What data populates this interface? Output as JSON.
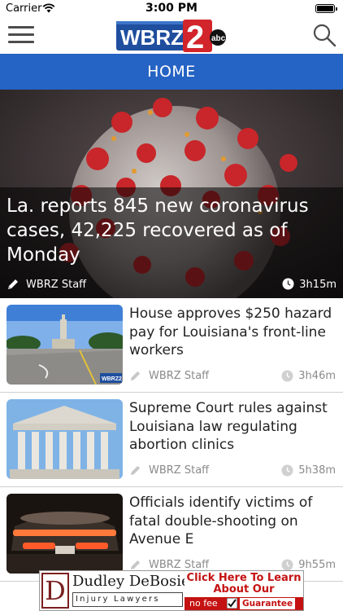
{
  "status_bar": {
    "carrier": "Carrier",
    "time": "3:00 PM"
  },
  "nav": {
    "logo_text": "WBRZ",
    "logo_number": "2",
    "logo_network": "abc"
  },
  "section": {
    "title": "HOME"
  },
  "hero": {
    "title": "La. reports 845 new coronavirus cases, 42,225 recovered as of Monday",
    "author": "WBRZ Staff",
    "time": "3h15m"
  },
  "articles": [
    {
      "title": "House approves $250 hazard pay for Louisiana's front-line workers",
      "author": "WBRZ Staff",
      "time": "3h46m",
      "watermark": "WBRZ2"
    },
    {
      "title": "Supreme Court rules against Louisiana law regulating abortion clinics",
      "author": "WBRZ Staff",
      "time": "5h38m"
    },
    {
      "title": "Officials identify victims of fatal double-shooting on Avenue E",
      "author": "WBRZ Staff",
      "time": "9h55m"
    }
  ],
  "ad": {
    "letter": "D",
    "name": "Dudley DeBosier",
    "subtitle": "Injury Lawyers",
    "cta_line1": "Click Here To Learn",
    "cta_line2": "About Our",
    "nofee": "no fee",
    "guarantee": "Guarantee"
  },
  "colors": {
    "section_bar": "#2563c4",
    "logo_red": "#d2242b",
    "logo_blue": "#1f4e9e"
  }
}
